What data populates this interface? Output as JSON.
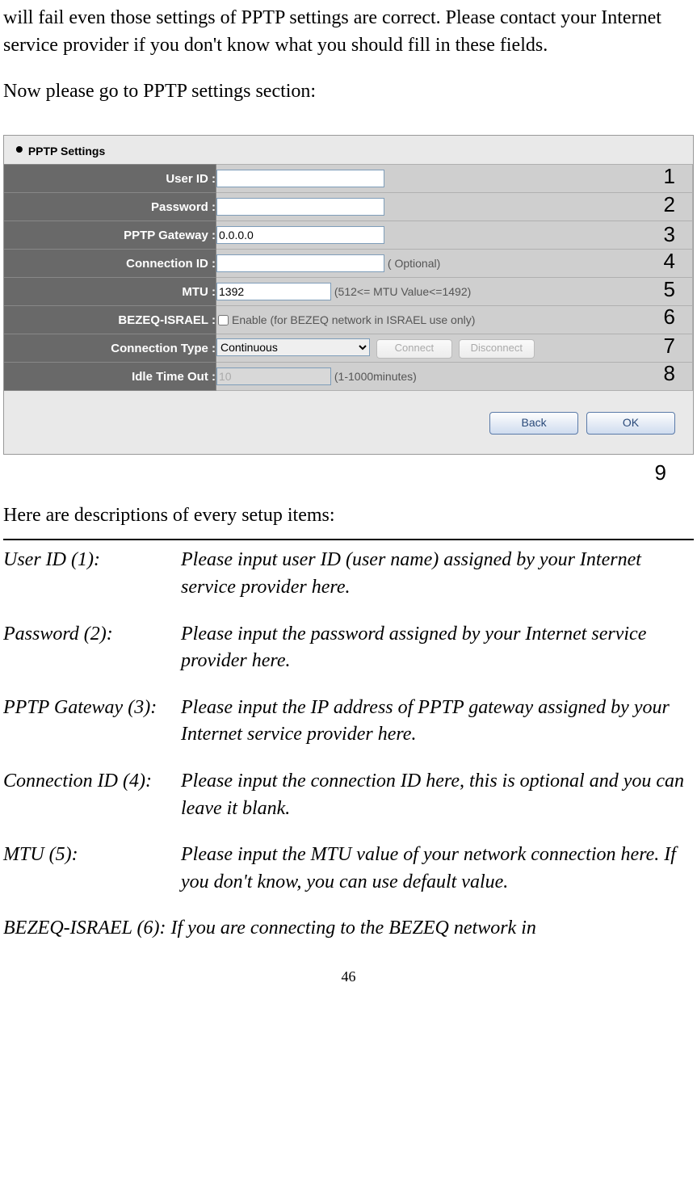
{
  "intro": {
    "p1": "will fail even those settings of PPTP settings are correct. Please contact your Internet service provider if you don't know what you should fill in these fields.",
    "p2": "Now please go to PPTP settings section:"
  },
  "settings": {
    "header_bullet": "•",
    "header": "PPTP Settings",
    "row1": {
      "label": "User ID :",
      "value": "",
      "anno": "1"
    },
    "row2": {
      "label": "Password :",
      "value": "",
      "anno": "2"
    },
    "row3": {
      "label": "PPTP Gateway :",
      "value": "0.0.0.0",
      "anno": "3"
    },
    "row4": {
      "label": "Connection ID :",
      "value": "",
      "hint": "( Optional)",
      "anno": "4"
    },
    "row5": {
      "label": "MTU :",
      "value": "1392",
      "hint": "(512<= MTU Value<=1492)",
      "anno": "5"
    },
    "row6": {
      "label": "BEZEQ-ISRAEL :",
      "checkbox_label": "Enable (for BEZEQ network in ISRAEL use only)",
      "anno": "6"
    },
    "row7": {
      "label": "Connection Type :",
      "select_value": "Continuous",
      "btn_connect": "Connect",
      "btn_disconnect": "Disconnect",
      "anno": "7"
    },
    "row8": {
      "label": "Idle Time Out :",
      "value": "10",
      "hint": "(1-1000minutes)",
      "anno": "8"
    },
    "footer": {
      "back": "Back",
      "ok": "OK"
    },
    "anno9": "9"
  },
  "desc_heading": "Here are descriptions of every setup items:",
  "descriptions": {
    "d1": {
      "label": "User ID (1):",
      "text": "Please input user ID (user name) assigned by your Internet service provider here."
    },
    "d2": {
      "label": "Password (2):",
      "text": "Please input the password assigned by your Internet service provider here."
    },
    "d3": {
      "label": "PPTP Gateway (3):",
      "text": "Please input the IP address of PPTP gateway assigned by your Internet service provider here."
    },
    "d4": {
      "label": "Connection ID (4):",
      "text": "Please input the connection ID here, this is optional and you can leave it blank."
    },
    "d5": {
      "label": "MTU (5):",
      "text": "Please input the MTU value of your network connection here. If you don't know, you can use default value."
    },
    "d6": "BEZEQ-ISRAEL (6): If you are connecting to the BEZEQ network in"
  },
  "page_number": "46"
}
